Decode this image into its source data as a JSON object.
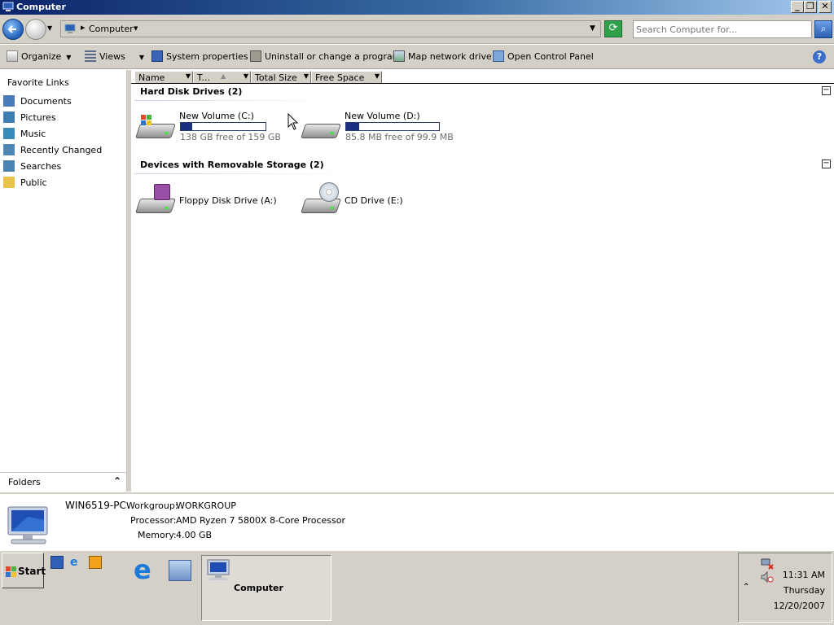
{
  "window": {
    "title": "Computer"
  },
  "address": {
    "crumb": "Computer"
  },
  "search": {
    "placeholder": "Search Computer for..."
  },
  "toolbar": {
    "organize": "Organize",
    "views": "Views",
    "system_properties": "System properties",
    "uninstall": "Uninstall or change a program",
    "map_drive": "Map network drive",
    "control_panel": "Open Control Panel"
  },
  "sidebar": {
    "title": "Favorite Links",
    "items": [
      {
        "label": "Documents",
        "icon": "documents-icon",
        "color": "#4a7ab8"
      },
      {
        "label": "Pictures",
        "icon": "pictures-icon",
        "color": "#3e7fb0"
      },
      {
        "label": "Music",
        "icon": "music-icon",
        "color": "#3a8ab8"
      },
      {
        "label": "Recently Changed",
        "icon": "recent-icon",
        "color": "#4f86b4"
      },
      {
        "label": "Searches",
        "icon": "searches-icon",
        "color": "#4b84b0"
      },
      {
        "label": "Public",
        "icon": "folder-icon",
        "color": "#e8c24a"
      }
    ],
    "folders_label": "Folders"
  },
  "columns": [
    "Name",
    "T...",
    "Total Size",
    "Free Space"
  ],
  "groups": [
    {
      "title": "Hard Disk Drives (2)",
      "drives": [
        {
          "name": "New Volume (C:)",
          "free_text": "138 GB free of 159 GB",
          "used_fraction": 0.13
        },
        {
          "name": "New Volume (D:)",
          "free_text": "85.8 MB free of 99.9 MB",
          "used_fraction": 0.14
        }
      ]
    },
    {
      "title": "Devices with Removable Storage (2)",
      "devices": [
        {
          "name": "Floppy Disk Drive (A:)"
        },
        {
          "name": "CD Drive (E:)"
        }
      ]
    }
  ],
  "details": {
    "computer_name": "WIN6519-PC",
    "workgroup_label": "Workgroup:",
    "workgroup": "WORKGROUP",
    "processor_label": "Processor:",
    "processor": "AMD Ryzen 7 5800X 8-Core Processor",
    "memory_label": "Memory:",
    "memory": "4.00 GB"
  },
  "taskbar": {
    "start": "Start",
    "active_task": "Computer",
    "time": "11:31 AM",
    "day": "Thursday",
    "date": "12/20/2007"
  },
  "colors": {
    "accent": "#0a246a",
    "bar_fill": "#1a2f80",
    "chrome": "#d4d0c8"
  }
}
